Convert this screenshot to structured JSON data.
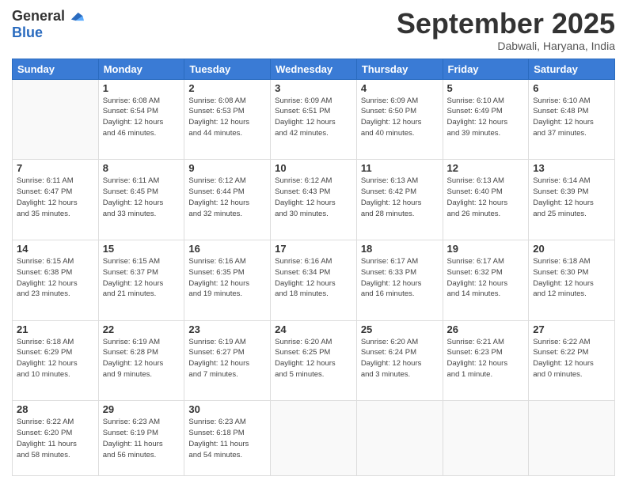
{
  "header": {
    "logo_general": "General",
    "logo_blue": "Blue",
    "month": "September 2025",
    "location": "Dabwali, Haryana, India"
  },
  "weekdays": [
    "Sunday",
    "Monday",
    "Tuesday",
    "Wednesday",
    "Thursday",
    "Friday",
    "Saturday"
  ],
  "weeks": [
    [
      {
        "day": "",
        "info": ""
      },
      {
        "day": "1",
        "info": "Sunrise: 6:08 AM\nSunset: 6:54 PM\nDaylight: 12 hours\nand 46 minutes."
      },
      {
        "day": "2",
        "info": "Sunrise: 6:08 AM\nSunset: 6:53 PM\nDaylight: 12 hours\nand 44 minutes."
      },
      {
        "day": "3",
        "info": "Sunrise: 6:09 AM\nSunset: 6:51 PM\nDaylight: 12 hours\nand 42 minutes."
      },
      {
        "day": "4",
        "info": "Sunrise: 6:09 AM\nSunset: 6:50 PM\nDaylight: 12 hours\nand 40 minutes."
      },
      {
        "day": "5",
        "info": "Sunrise: 6:10 AM\nSunset: 6:49 PM\nDaylight: 12 hours\nand 39 minutes."
      },
      {
        "day": "6",
        "info": "Sunrise: 6:10 AM\nSunset: 6:48 PM\nDaylight: 12 hours\nand 37 minutes."
      }
    ],
    [
      {
        "day": "7",
        "info": "Sunrise: 6:11 AM\nSunset: 6:47 PM\nDaylight: 12 hours\nand 35 minutes."
      },
      {
        "day": "8",
        "info": "Sunrise: 6:11 AM\nSunset: 6:45 PM\nDaylight: 12 hours\nand 33 minutes."
      },
      {
        "day": "9",
        "info": "Sunrise: 6:12 AM\nSunset: 6:44 PM\nDaylight: 12 hours\nand 32 minutes."
      },
      {
        "day": "10",
        "info": "Sunrise: 6:12 AM\nSunset: 6:43 PM\nDaylight: 12 hours\nand 30 minutes."
      },
      {
        "day": "11",
        "info": "Sunrise: 6:13 AM\nSunset: 6:42 PM\nDaylight: 12 hours\nand 28 minutes."
      },
      {
        "day": "12",
        "info": "Sunrise: 6:13 AM\nSunset: 6:40 PM\nDaylight: 12 hours\nand 26 minutes."
      },
      {
        "day": "13",
        "info": "Sunrise: 6:14 AM\nSunset: 6:39 PM\nDaylight: 12 hours\nand 25 minutes."
      }
    ],
    [
      {
        "day": "14",
        "info": "Sunrise: 6:15 AM\nSunset: 6:38 PM\nDaylight: 12 hours\nand 23 minutes."
      },
      {
        "day": "15",
        "info": "Sunrise: 6:15 AM\nSunset: 6:37 PM\nDaylight: 12 hours\nand 21 minutes."
      },
      {
        "day": "16",
        "info": "Sunrise: 6:16 AM\nSunset: 6:35 PM\nDaylight: 12 hours\nand 19 minutes."
      },
      {
        "day": "17",
        "info": "Sunrise: 6:16 AM\nSunset: 6:34 PM\nDaylight: 12 hours\nand 18 minutes."
      },
      {
        "day": "18",
        "info": "Sunrise: 6:17 AM\nSunset: 6:33 PM\nDaylight: 12 hours\nand 16 minutes."
      },
      {
        "day": "19",
        "info": "Sunrise: 6:17 AM\nSunset: 6:32 PM\nDaylight: 12 hours\nand 14 minutes."
      },
      {
        "day": "20",
        "info": "Sunrise: 6:18 AM\nSunset: 6:30 PM\nDaylight: 12 hours\nand 12 minutes."
      }
    ],
    [
      {
        "day": "21",
        "info": "Sunrise: 6:18 AM\nSunset: 6:29 PM\nDaylight: 12 hours\nand 10 minutes."
      },
      {
        "day": "22",
        "info": "Sunrise: 6:19 AM\nSunset: 6:28 PM\nDaylight: 12 hours\nand 9 minutes."
      },
      {
        "day": "23",
        "info": "Sunrise: 6:19 AM\nSunset: 6:27 PM\nDaylight: 12 hours\nand 7 minutes."
      },
      {
        "day": "24",
        "info": "Sunrise: 6:20 AM\nSunset: 6:25 PM\nDaylight: 12 hours\nand 5 minutes."
      },
      {
        "day": "25",
        "info": "Sunrise: 6:20 AM\nSunset: 6:24 PM\nDaylight: 12 hours\nand 3 minutes."
      },
      {
        "day": "26",
        "info": "Sunrise: 6:21 AM\nSunset: 6:23 PM\nDaylight: 12 hours\nand 1 minute."
      },
      {
        "day": "27",
        "info": "Sunrise: 6:22 AM\nSunset: 6:22 PM\nDaylight: 12 hours\nand 0 minutes."
      }
    ],
    [
      {
        "day": "28",
        "info": "Sunrise: 6:22 AM\nSunset: 6:20 PM\nDaylight: 11 hours\nand 58 minutes."
      },
      {
        "day": "29",
        "info": "Sunrise: 6:23 AM\nSunset: 6:19 PM\nDaylight: 11 hours\nand 56 minutes."
      },
      {
        "day": "30",
        "info": "Sunrise: 6:23 AM\nSunset: 6:18 PM\nDaylight: 11 hours\nand 54 minutes."
      },
      {
        "day": "",
        "info": ""
      },
      {
        "day": "",
        "info": ""
      },
      {
        "day": "",
        "info": ""
      },
      {
        "day": "",
        "info": ""
      }
    ]
  ]
}
